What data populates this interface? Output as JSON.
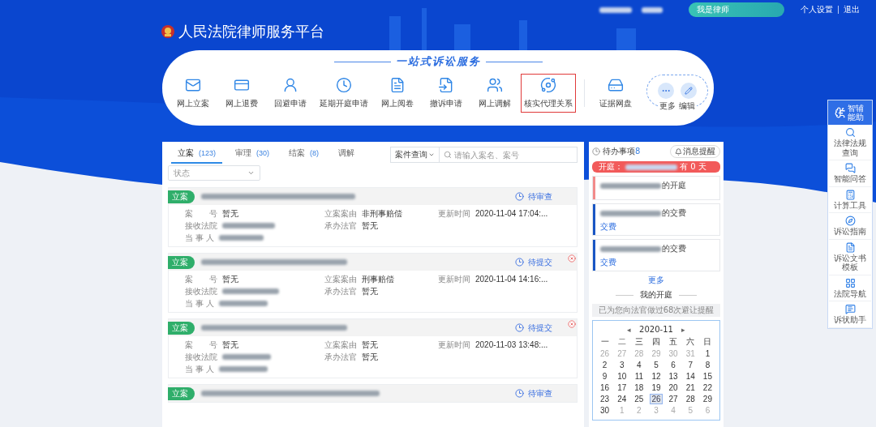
{
  "top_bar": {
    "role_button": "我是律师",
    "links": [
      "个人设置",
      "退出"
    ]
  },
  "brand": {
    "title": "人民法院律师服务平台"
  },
  "services": {
    "title": "一站式诉讼服务",
    "items": [
      {
        "label": "网上立案",
        "highlighted": false
      },
      {
        "label": "网上退费",
        "highlighted": false
      },
      {
        "label": "回避申请",
        "highlighted": false
      },
      {
        "label": "延期开庭申请",
        "highlighted": false
      },
      {
        "label": "网上阅卷",
        "highlighted": false
      },
      {
        "label": "撤诉申请",
        "highlighted": false
      },
      {
        "label": "网上调解",
        "highlighted": false
      },
      {
        "label": "核实代理关系",
        "highlighted": true
      },
      {
        "label": "证据网盘",
        "highlighted": false
      }
    ],
    "more": "更多",
    "edit": "编辑"
  },
  "case_tabs": [
    {
      "label": "立案",
      "count": "(123)",
      "selected": true
    },
    {
      "label": "审理",
      "count": "(30)",
      "selected": false
    },
    {
      "label": "结案",
      "count": "(8)",
      "selected": false
    },
    {
      "label": "调解",
      "selected": false
    }
  ],
  "search": {
    "scope": "案件查询",
    "placeholder": "请输入案名、案号"
  },
  "status_filter": {
    "placeholder": "状态"
  },
  "cases": [
    {
      "tag": "立案",
      "status": "待审查",
      "deletable": false,
      "fields": [
        {
          "label": "案　　号",
          "value": "暂无"
        },
        {
          "label": "立案案由",
          "value": "非刑事赔偿"
        },
        {
          "label": "更新时间",
          "value": "2020-11-04 17:04:..."
        },
        {
          "label": "接收法院"
        },
        {
          "label": "承办法官",
          "value": "暂无"
        },
        {
          "label": "当 事 人"
        }
      ]
    },
    {
      "tag": "立案",
      "status": "待提交",
      "deletable": true,
      "fields": [
        {
          "label": "案　　号",
          "value": "暂无"
        },
        {
          "label": "立案案由",
          "value": "刑事赔偿"
        },
        {
          "label": "更新时间",
          "value": "2020-11-04 14:16:..."
        },
        {
          "label": "接收法院"
        },
        {
          "label": "承办法官",
          "value": "暂无"
        },
        {
          "label": "当 事 人"
        }
      ]
    },
    {
      "tag": "立案",
      "status": "待提交",
      "deletable": true,
      "fields": [
        {
          "label": "案　　号",
          "value": "暂无"
        },
        {
          "label": "立案案由",
          "value": "暂无"
        },
        {
          "label": "更新时间",
          "value": "2020-11-03 13:48:..."
        },
        {
          "label": "接收法院"
        },
        {
          "label": "承办法官",
          "value": "暂无"
        },
        {
          "label": "当 事 人"
        }
      ]
    },
    {
      "tag": "立案",
      "status": "待审查",
      "deletable": false
    }
  ],
  "todo": {
    "title": "待办事项",
    "count": "8",
    "reminder_button": "消息提醒",
    "alert": {
      "label": "开庭：",
      "tail": "有 0 天"
    },
    "items": [
      {
        "suffix": "的开庭",
        "color": "#f28b8b"
      },
      {
        "suffix": "的交费",
        "color": "#1a56c4",
        "action": "交费"
      },
      {
        "suffix": "的交费",
        "color": "#1a56c4",
        "action": "交费"
      }
    ],
    "more": "更多"
  },
  "hearings": {
    "title": "我的开庭",
    "notice": "已为您向法官做过68次避让提醒",
    "calendar": {
      "prev": "◂",
      "month": "2020-11",
      "next": "▸",
      "weekdays": [
        "一",
        "二",
        "三",
        "四",
        "五",
        "六",
        "日"
      ],
      "days": [
        {
          "label": "26",
          "muted": true,
          "selected": false
        },
        {
          "label": "27",
          "muted": true,
          "selected": false
        },
        {
          "label": "28",
          "muted": true,
          "selected": false
        },
        {
          "label": "29",
          "muted": true,
          "selected": false
        },
        {
          "label": "30",
          "muted": true,
          "selected": false
        },
        {
          "label": "31",
          "muted": true,
          "selected": false
        },
        {
          "label": "1",
          "muted": false,
          "selected": false
        },
        {
          "label": "2",
          "muted": false,
          "selected": false
        },
        {
          "label": "3",
          "muted": false,
          "selected": false
        },
        {
          "label": "4",
          "muted": false,
          "selected": false
        },
        {
          "label": "5",
          "muted": false,
          "selected": false
        },
        {
          "label": "6",
          "muted": false,
          "selected": false
        },
        {
          "label": "7",
          "muted": false,
          "selected": false
        },
        {
          "label": "8",
          "muted": false,
          "selected": false
        },
        {
          "label": "9",
          "muted": false,
          "selected": false
        },
        {
          "label": "10",
          "muted": false,
          "selected": false
        },
        {
          "label": "11",
          "muted": false,
          "selected": false
        },
        {
          "label": "12",
          "muted": false,
          "selected": false
        },
        {
          "label": "13",
          "muted": false,
          "selected": false
        },
        {
          "label": "14",
          "muted": false,
          "selected": false
        },
        {
          "label": "15",
          "muted": false,
          "selected": false
        },
        {
          "label": "16",
          "muted": false,
          "selected": false
        },
        {
          "label": "17",
          "muted": false,
          "selected": false
        },
        {
          "label": "18",
          "muted": false,
          "selected": false
        },
        {
          "label": "19",
          "muted": false,
          "selected": false
        },
        {
          "label": "20",
          "muted": false,
          "selected": false
        },
        {
          "label": "21",
          "muted": false,
          "selected": false
        },
        {
          "label": "22",
          "muted": false,
          "selected": false
        },
        {
          "label": "23",
          "muted": false,
          "selected": false
        },
        {
          "label": "24",
          "muted": false,
          "selected": false
        },
        {
          "label": "25",
          "muted": false,
          "selected": false
        },
        {
          "label": "26",
          "muted": false,
          "selected": true
        },
        {
          "label": "27",
          "muted": false,
          "selected": false
        },
        {
          "label": "28",
          "muted": false,
          "selected": false
        },
        {
          "label": "29",
          "muted": false,
          "selected": false
        },
        {
          "label": "30",
          "muted": false,
          "selected": false
        },
        {
          "label": "1",
          "muted": true,
          "selected": false
        },
        {
          "label": "2",
          "muted": true,
          "selected": false
        },
        {
          "label": "3",
          "muted": true,
          "selected": false
        },
        {
          "label": "4",
          "muted": true,
          "selected": false
        },
        {
          "label": "5",
          "muted": true,
          "selected": false
        },
        {
          "label": "6",
          "muted": true,
          "selected": false
        }
      ]
    }
  },
  "assistant": {
    "title": "智辅能助",
    "items": [
      "法律法规查询",
      "智能问答",
      "计算工具",
      "诉讼指南",
      "诉讼文书模板",
      "法院导航",
      "诉状助手"
    ]
  }
}
